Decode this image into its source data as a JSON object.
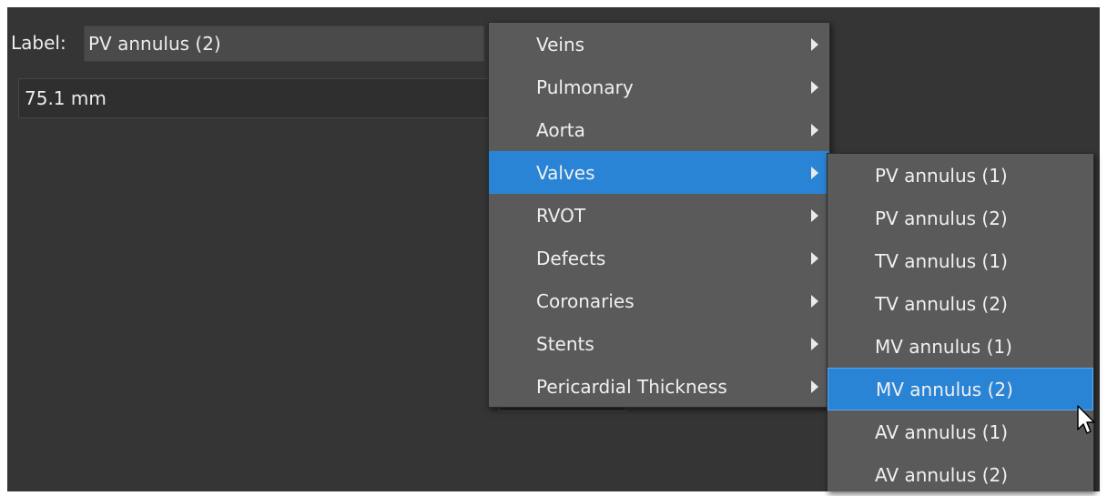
{
  "label_row": {
    "caption": "Label:",
    "value": "PV annulus (2)"
  },
  "measurement": {
    "value": "75.1 mm"
  },
  "menu": {
    "items": [
      {
        "label": "Veins",
        "has_submenu": true
      },
      {
        "label": "Pulmonary",
        "has_submenu": true
      },
      {
        "label": "Aorta",
        "has_submenu": true
      },
      {
        "label": "Valves",
        "has_submenu": true,
        "active": true
      },
      {
        "label": "RVOT",
        "has_submenu": true
      },
      {
        "label": "Defects",
        "has_submenu": true
      },
      {
        "label": "Coronaries",
        "has_submenu": true
      },
      {
        "label": "Stents",
        "has_submenu": true
      },
      {
        "label": "Pericardial Thickness",
        "has_submenu": true
      }
    ]
  },
  "submenu": {
    "items": [
      {
        "label": "PV annulus (1)"
      },
      {
        "label": "PV annulus (2)"
      },
      {
        "label": "TV annulus (1)"
      },
      {
        "label": "TV annulus (2)"
      },
      {
        "label": "MV annulus (1)"
      },
      {
        "label": "MV annulus (2)",
        "active": true
      },
      {
        "label": "AV annulus (1)"
      },
      {
        "label": "AV annulus (2)"
      }
    ]
  },
  "colors": {
    "background": "#353535",
    "menu_background": "#5a5a5a",
    "highlight": "#2a84d6"
  },
  "icons": {
    "submenu_arrow": "chevron-right-icon",
    "cursor": "mouse-pointer-icon"
  }
}
